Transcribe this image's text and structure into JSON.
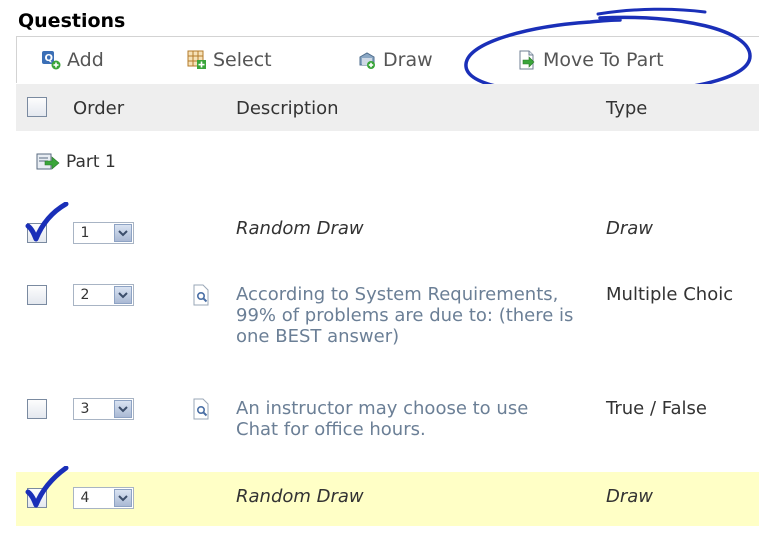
{
  "section": {
    "title": "Questions"
  },
  "toolbar": {
    "add_label": "Add",
    "select_label": "Select",
    "draw_label": "Draw",
    "move_label": "Move To Part"
  },
  "table": {
    "headers": {
      "order": "Order",
      "description": "Description",
      "type": "Type"
    }
  },
  "part": {
    "label": "Part 1"
  },
  "rows": [
    {
      "order": "1",
      "description": "Random Draw",
      "type": "Draw",
      "checked": true
    },
    {
      "order": "2",
      "description": "According to System Requirements, 99% of problems are due to: (there is one BEST answer)",
      "type": "Multiple Choic",
      "checked": false
    },
    {
      "order": "3",
      "description": "An instructor may choose to use Chat for office hours.",
      "type": "True / False",
      "checked": false
    },
    {
      "order": "4",
      "description": "Random Draw",
      "type": "Draw",
      "checked": true,
      "highlighted": true
    }
  ],
  "colors": {
    "annotation": "#1a2fb8",
    "highlight": "#ffffc6",
    "header_bg": "#eeeeee",
    "link_text": "#6b7f96"
  }
}
